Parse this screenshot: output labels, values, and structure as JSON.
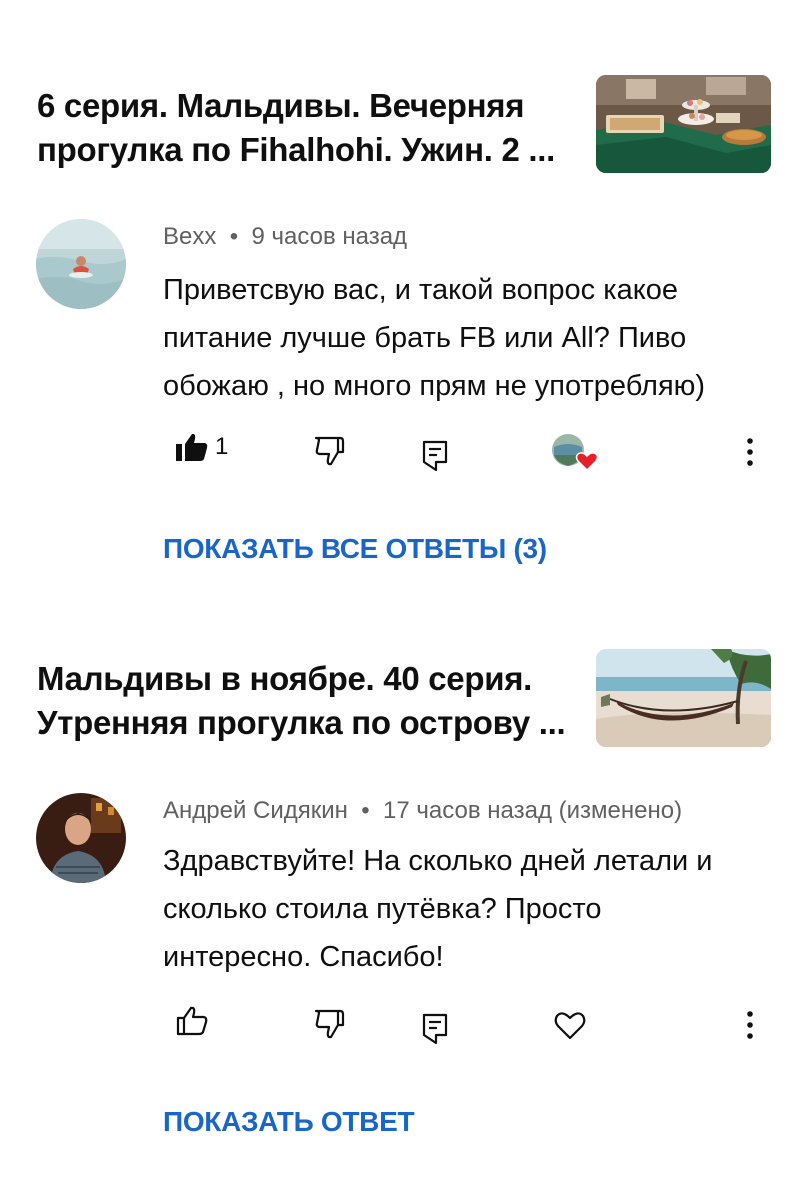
{
  "comments": [
    {
      "video_title": "6 серия. Мальдивы. Вечерняя прогулка по Fihalhohi. Ужин. 2 ...",
      "thumbnail_icon": "buffet-dinner-thumbnail",
      "author": "Bexx",
      "time": "9 часов назад",
      "text_lines": [
        "Приветсвую вас, и  такой вопрос  какое",
        "питание лучше брать  FB или All?   Пиво",
        "обожаю , но много прям не употребляю)"
      ],
      "like_count": "1",
      "liked": true,
      "creator_hearted": true,
      "show_replies_label": "ПОКАЗАТЬ ВСЕ ОТВЕТЫ (3)"
    },
    {
      "video_title": "Мальдивы в ноябре. 40 серия. Утренняя прогулка по острову ...",
      "thumbnail_icon": "beach-hammock-thumbnail",
      "author": "Андрей Сидякин",
      "time": "17 часов назад (изменено)",
      "text_lines": [
        "Здравствуйте! На сколько дней летали и",
        "сколько стоила путёвка? Просто",
        "интересно. Спасибо!"
      ],
      "like_count": "",
      "liked": false,
      "creator_hearted": false,
      "show_replies_label": "ПОКАЗАТЬ ОТВЕТ"
    }
  ],
  "colors": {
    "link_blue": "#1a66c8",
    "meta_gray": "#606060",
    "heart_red": "#e5202a"
  }
}
